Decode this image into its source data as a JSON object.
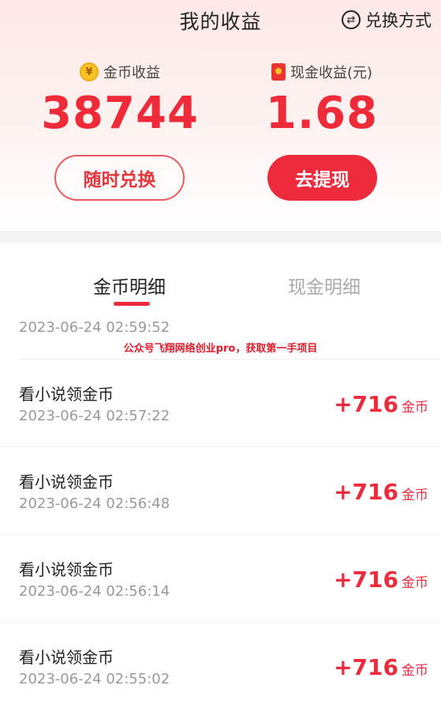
{
  "header": {
    "title": "我的收益",
    "exchange_mode_label": "兑换方式"
  },
  "summary": {
    "coin_label": "金币收益",
    "coin_value": "38744",
    "cash_label": "现金收益(元)",
    "cash_value": "1.68"
  },
  "actions": {
    "exchange_label": "随时兑换",
    "withdraw_label": "去提现"
  },
  "tabs": [
    {
      "label": "金币明细",
      "active": true
    },
    {
      "label": "现金明细",
      "active": false
    }
  ],
  "list": {
    "partial_time": "2023-06-24 02:59:52",
    "watermark": "公众号飞翔网络创业pro，获取第一手项目",
    "rows": [
      {
        "title": "看小说领金币",
        "time": "2023-06-24 02:57:22",
        "amount": "+716",
        "unit": "金币"
      },
      {
        "title": "看小说领金币",
        "time": "2023-06-24 02:56:48",
        "amount": "+716",
        "unit": "金币"
      },
      {
        "title": "看小说领金币",
        "time": "2023-06-24 02:56:14",
        "amount": "+716",
        "unit": "金币"
      },
      {
        "title": "看小说领金币",
        "time": "2023-06-24 02:55:02",
        "amount": "+716",
        "unit": "金币"
      }
    ]
  },
  "colors": {
    "accent": "#ee2b3c",
    "coin": "#f7c325"
  },
  "icons": {
    "exchange": "exchange-icon",
    "coin": "coin-icon",
    "cash": "red-packet-icon"
  }
}
